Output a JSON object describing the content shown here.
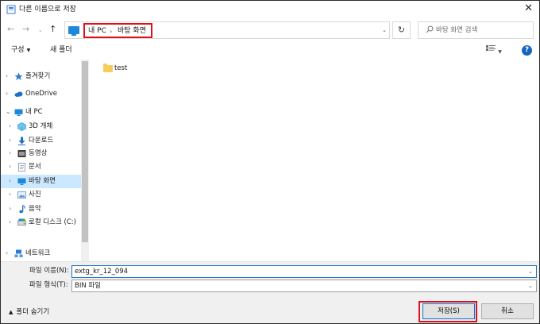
{
  "window": {
    "title": "다른 이름으로 저장",
    "close_glyph": "✕"
  },
  "nav": {
    "back_glyph": "←",
    "forward_glyph": "→",
    "recent_glyph": "⌄",
    "up_glyph": "↑",
    "breadcrumb": [
      "내 PC",
      "바탕 화면"
    ],
    "breadcrumb_sep": "›",
    "refresh_glyph": "↻",
    "search_placeholder": "바탕 화면 검색"
  },
  "toolbar": {
    "organize_label": "구성",
    "new_folder_label": "새 폴더"
  },
  "sidebar": {
    "items": [
      {
        "label": "즐겨찾기",
        "icon": "star-icon",
        "expander": "›"
      },
      {
        "label": "OneDrive",
        "icon": "cloud-icon",
        "expander": "›"
      },
      {
        "label": "내 PC",
        "icon": "pc-icon",
        "expander": "⌄"
      },
      {
        "label": "3D 개체",
        "icon": "cube-icon",
        "expander": "›"
      },
      {
        "label": "다운로드",
        "icon": "download-icon",
        "expander": "›"
      },
      {
        "label": "동영상",
        "icon": "video-icon",
        "expander": "›"
      },
      {
        "label": "문서",
        "icon": "document-icon",
        "expander": "›"
      },
      {
        "label": "바탕 화면",
        "icon": "desktop-icon",
        "expander": "›",
        "selected": true
      },
      {
        "label": "사진",
        "icon": "pictures-icon",
        "expander": "›"
      },
      {
        "label": "음악",
        "icon": "music-icon",
        "expander": "›"
      },
      {
        "label": "로컬 디스크 (C:)",
        "icon": "disk-icon",
        "expander": "›"
      },
      {
        "label": "네트워크",
        "icon": "network-icon",
        "expander": "›"
      }
    ]
  },
  "files": [
    {
      "name": "test",
      "type": "folder"
    }
  ],
  "fields": {
    "filename_label": "파일 이름(N):",
    "filename_value": "extg_kr_12_094",
    "filetype_label": "파일 형식(T):",
    "filetype_value": "BIN 파일"
  },
  "footer": {
    "hide_folders_label": "폴더 숨기기",
    "save_label": "저장(S)",
    "cancel_label": "취소"
  },
  "colors": {
    "accent": "#0078d7",
    "highlight_box": "#e0101a",
    "selected_bg": "#cce8ff"
  }
}
